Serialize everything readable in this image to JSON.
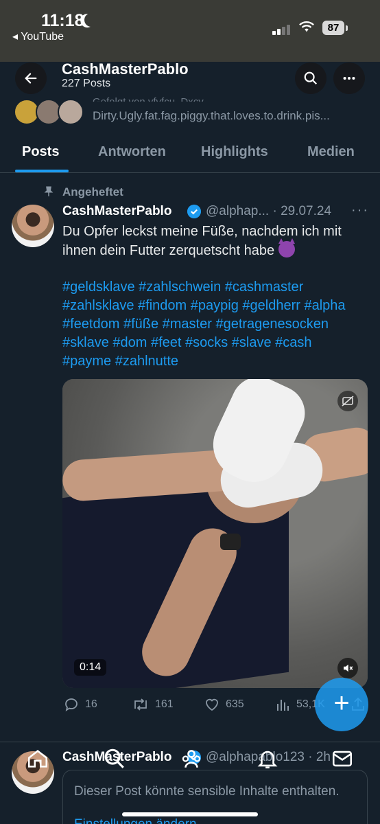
{
  "status": {
    "time": "11:18",
    "back_app": "◂ YouTube",
    "battery": "87"
  },
  "profile": {
    "name": "CashMasterPablo",
    "post_count": "227 Posts",
    "bio_line_partial": "Gefolgt von yfvfcu, Dxcv,",
    "bio_line": "Dirty.Ugly.fat.fag.piggy.that.loves.to.drink.pis..."
  },
  "tabs": [
    {
      "label": "Posts",
      "active": true
    },
    {
      "label": "Antworten",
      "active": false
    },
    {
      "label": "Highlights",
      "active": false
    },
    {
      "label": "Medien",
      "active": false
    }
  ],
  "pinned_post": {
    "pinned_label": "Angeheftet",
    "author": "CashMasterPablo",
    "handle": "@alphap... · 29.07.24",
    "text": "Du Opfer leckst meine Füße, nachdem ich mit ihnen dein Futter zerquetscht habe",
    "hashtags": "#geldsklave #zahlschwein #cashmaster #zahlsklave #findom #paypig #geldherr #alpha #feetdom #füße #master #getragenesocken #sklave #dom #feet #socks #slave #cash #payme #zahlnutte",
    "video_duration": "0:14",
    "replies": "16",
    "reposts": "161",
    "likes": "635",
    "views": "53,1K"
  },
  "next_post": {
    "author": "CashMasterPablo",
    "handle": "@alphapablo123 · 2h",
    "sensitive_text": "Dieser Post könnte sensible Inhalte enthalten.",
    "sensitive_link": "Einstellungen ändern"
  },
  "colors": {
    "background": "#15202b",
    "accent": "#1d9bf0",
    "muted": "#8b98a5"
  }
}
